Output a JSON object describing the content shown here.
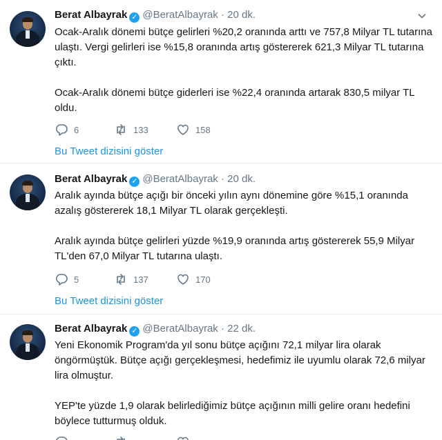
{
  "tweets": [
    {
      "name": "Berat Albayrak",
      "handle": "@BeratAlbayrak",
      "dot": "·",
      "time": "20 dk.",
      "paragraphs": [
        "Ocak-Aralık dönemi bütçe gelirleri %20,2 oranında arttı ve 757,8 Milyar TL tutarına ulaştı. Vergi gelirleri ise %15,8 oranında artış göstererek 621,3 Milyar TL tutarına çıktı.",
        "Ocak-Aralık dönemi bütçe giderleri ise %22,4 oranında artarak 830,5 milyar TL oldu."
      ],
      "replies": "6",
      "retweets": "133",
      "likes": "158",
      "thread_link": "Bu Tweet dizisini göster"
    },
    {
      "name": "Berat Albayrak",
      "handle": "@BeratAlbayrak",
      "dot": "·",
      "time": "20 dk.",
      "paragraphs": [
        "Aralık ayında bütçe açığı bir önceki yılın aynı dönemine göre %15,1 oranında azalış göstererek 18,1 Milyar TL olarak gerçekleşti.",
        "Aralık ayında bütçe gelirleri yüzde %19,9 oranında artış göstererek 55,9 Milyar TL'den 67,0 Milyar TL tutarına ulaştı."
      ],
      "replies": "5",
      "retweets": "137",
      "likes": "170",
      "thread_link": "Bu Tweet dizisini göster"
    },
    {
      "name": "Berat Albayrak",
      "handle": "@BeratAlbayrak",
      "dot": "·",
      "time": "22 dk.",
      "paragraphs": [
        "Yeni Ekonomik Program'da yıl sonu bütçe açığını 72,1 milyar lira olarak öngörmüştük. Bütçe açığı gerçekleşmesi, hedefimiz ile uyumlu olarak 72,6 milyar lira olmuştur.",
        "YEP'te yüzde 1,9 olarak belirlediğimiz bütçe açığının milli gelire oranı hedefini böylece tutturmuş olduk."
      ]
    }
  ],
  "icons": {
    "reply": "reply-icon",
    "retweet": "retweet-icon",
    "like": "heart-icon",
    "caret": "chevron-down-icon",
    "verified": "verified-badge-icon"
  },
  "colors": {
    "link": "#1b95e0",
    "muted": "#657786",
    "verified": "#1da1f2",
    "separator": "#e6ecf0"
  }
}
